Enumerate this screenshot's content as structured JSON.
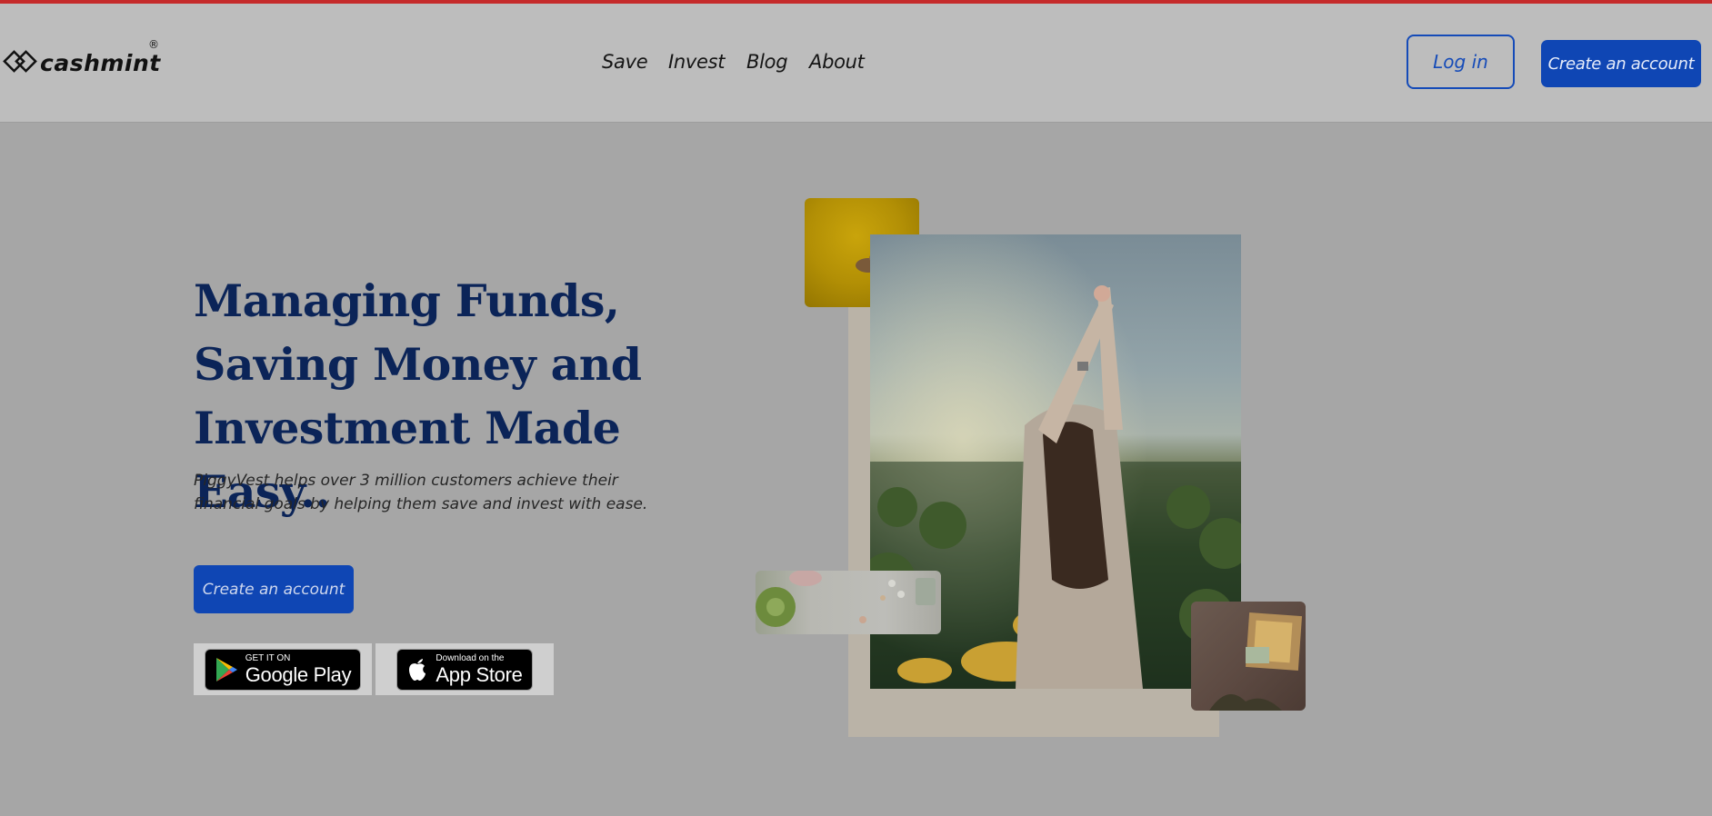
{
  "brand": {
    "name": "cashmint",
    "registered_mark": "®"
  },
  "nav": {
    "items": [
      {
        "label": "Save"
      },
      {
        "label": "Invest"
      },
      {
        "label": "Blog"
      },
      {
        "label": "About"
      }
    ],
    "login_label": "Log in",
    "create_account_label": "Create an account"
  },
  "hero": {
    "title": "Managing Funds, Saving Money and Investment Made Easy..",
    "subtitle": "PiggyVest helps over 3 million customers achieve their financial goals by helping them save and invest with ease.",
    "cta_label": "Create an account"
  },
  "stores": {
    "google": {
      "small": "GET IT ON",
      "big": "Google Play"
    },
    "apple": {
      "small": "Download on the",
      "big": "App Store"
    }
  },
  "colors": {
    "accent": "#0f46b4",
    "title": "#0b2458",
    "top_line": "#c52b2b"
  },
  "icons": [
    "logo-diamond-icon",
    "google-play-icon",
    "apple-icon"
  ]
}
